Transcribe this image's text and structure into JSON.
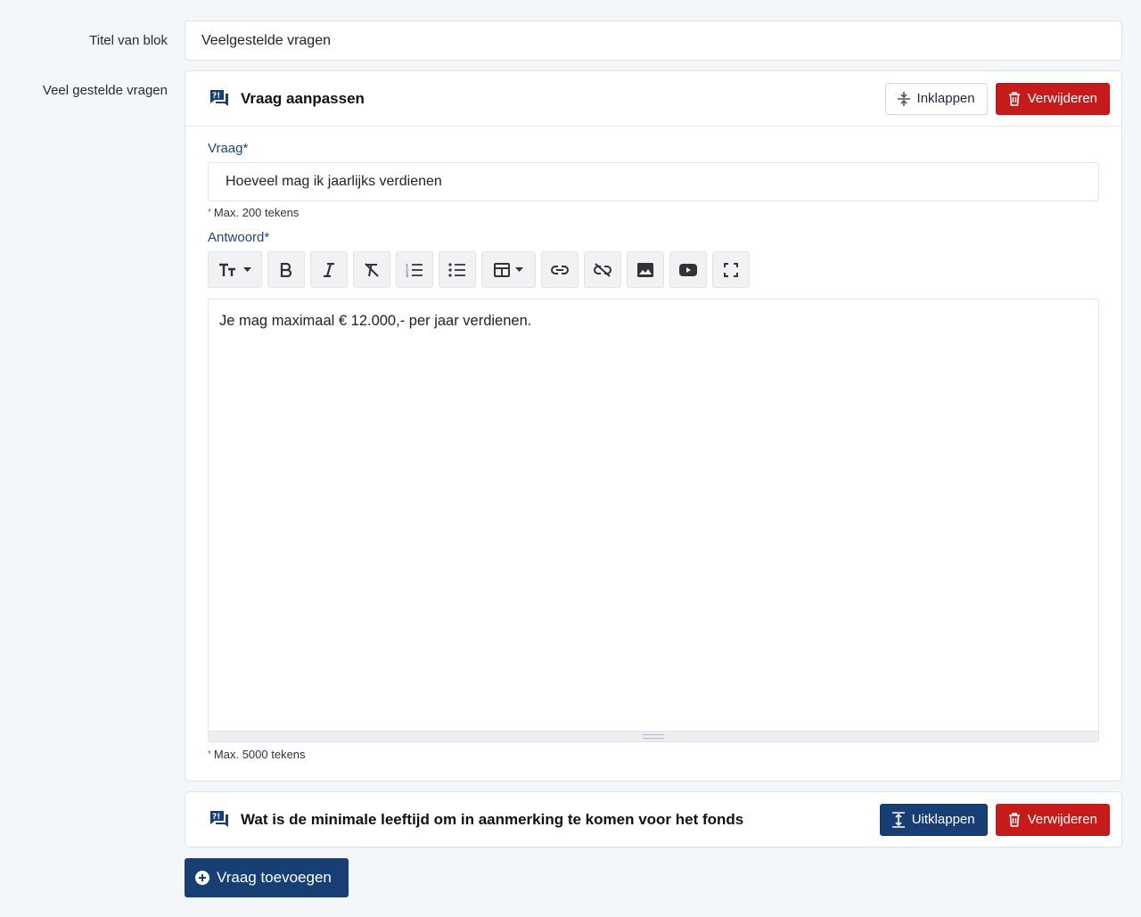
{
  "block_title": {
    "label": "Titel van blok",
    "value": "Veelgestelde vragen"
  },
  "faq_section": {
    "label": "Veel gestelde vragen"
  },
  "question_1": {
    "header_title": "Vraag aanpassen",
    "collapse_label": "Inklappen",
    "delete_label": "Verwijderen",
    "question_label": "Vraag*",
    "question_value": "Hoeveel mag ik jaarlijks verdienen",
    "question_hint": "Max. 200 tekens",
    "answer_label": "Antwoord*",
    "answer_value": "Je mag maximaal € 12.000,- per jaar verdienen.",
    "answer_hint": "Max. 5000 tekens",
    "toolbar": [
      "text-size-icon",
      "bold-icon",
      "italic-icon",
      "clear-format-icon",
      "ordered-list-icon",
      "unordered-list-icon",
      "table-icon",
      "link-icon",
      "unlink-icon",
      "image-icon",
      "video-icon",
      "fullscreen-icon"
    ]
  },
  "question_2": {
    "header_title": "Wat is de minimale leeftijd om in aanmerking te komen voor het fonds",
    "expand_label": "Uitklappen",
    "delete_label": "Verwijderen"
  },
  "add_question_label": "Vraag toevoegen",
  "colors": {
    "primary": "#173f74",
    "danger": "#c71b1b",
    "label_blue": "#1f4480",
    "background": "#f4f7fa"
  }
}
